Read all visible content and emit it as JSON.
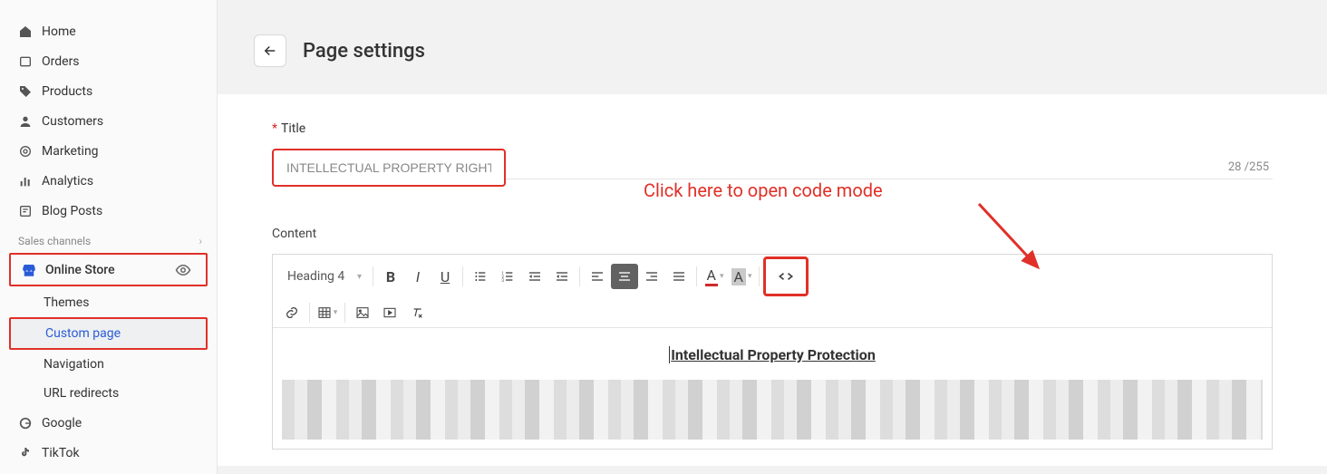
{
  "sidebar": {
    "items": [
      {
        "label": "Home"
      },
      {
        "label": "Orders"
      },
      {
        "label": "Products"
      },
      {
        "label": "Customers"
      },
      {
        "label": "Marketing"
      },
      {
        "label": "Analytics"
      },
      {
        "label": "Blog Posts"
      }
    ],
    "section_label": "Sales channels",
    "online_store_label": "Online Store",
    "subs": [
      {
        "label": "Themes"
      },
      {
        "label": "Custom page"
      },
      {
        "label": "Navigation"
      },
      {
        "label": "URL redirects"
      }
    ],
    "channels": [
      {
        "label": "Google"
      },
      {
        "label": "TikTok"
      }
    ]
  },
  "header": {
    "title": "Page settings"
  },
  "title_field": {
    "label": "Title",
    "value": "INTELLECTUAL PROPERTY RIGHTS",
    "count": "28 /255"
  },
  "annotation": {
    "text": "Click here to open code mode"
  },
  "content": {
    "label": "Content",
    "heading_select": "Heading 4",
    "body_heading": "Intellectual Property Protection"
  }
}
